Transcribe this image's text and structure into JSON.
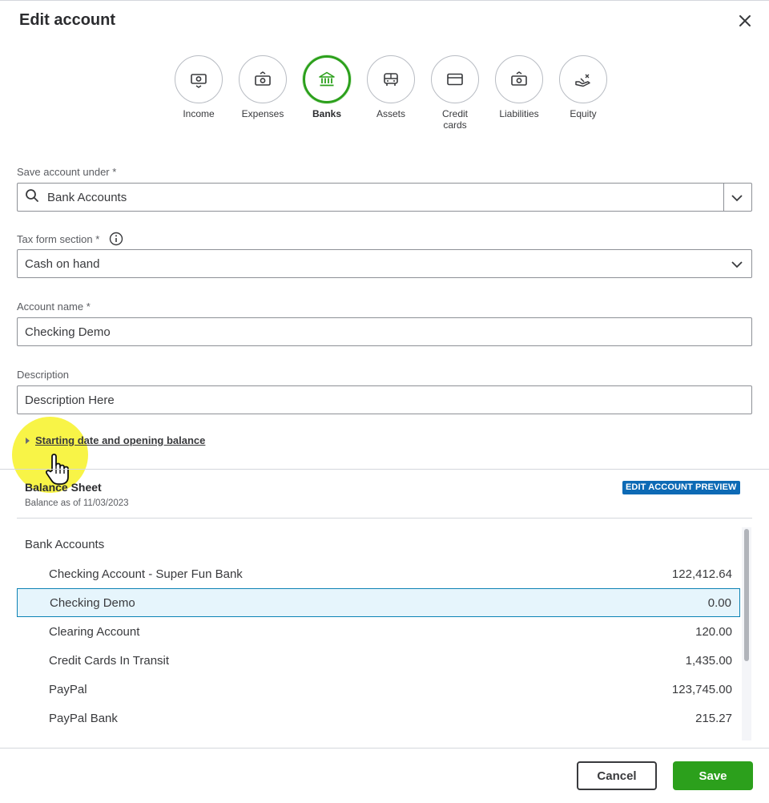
{
  "dialog": {
    "title": "Edit account"
  },
  "account_types": [
    {
      "label": "Income",
      "icon": "income-icon",
      "active": false
    },
    {
      "label": "Expenses",
      "icon": "expenses-icon",
      "active": false
    },
    {
      "label": "Banks",
      "icon": "bank-icon",
      "active": true
    },
    {
      "label": "Assets",
      "icon": "assets-icon",
      "active": false
    },
    {
      "label": "Credit cards",
      "icon": "credit-card-icon",
      "active": false
    },
    {
      "label": "Liabilities",
      "icon": "liabilities-icon",
      "active": false
    },
    {
      "label": "Equity",
      "icon": "equity-icon",
      "active": false
    }
  ],
  "form": {
    "save_under_label": "Save account under *",
    "save_under_value": "Bank Accounts",
    "tax_form_label": "Tax form section *",
    "tax_form_value": "Cash on hand",
    "account_name_label": "Account name *",
    "account_name_value": "Checking Demo",
    "description_label": "Description",
    "description_value": "Description Here",
    "opening_balance_link": "Starting date and opening balance"
  },
  "preview": {
    "title": "Balance Sheet",
    "subtitle": "Balance as of 11/03/2023",
    "badge": "EDIT ACCOUNT PREVIEW",
    "section": "Bank Accounts",
    "rows": [
      {
        "name": "Checking Account - Super Fun Bank",
        "amount": "122,412.64",
        "selected": false
      },
      {
        "name": "Checking Demo",
        "amount": "0.00",
        "selected": true
      },
      {
        "name": "Clearing Account",
        "amount": "120.00",
        "selected": false
      },
      {
        "name": "Credit Cards In Transit",
        "amount": "1,435.00",
        "selected": false
      },
      {
        "name": "PayPal",
        "amount": "123,745.00",
        "selected": false
      },
      {
        "name": "PayPal Bank",
        "amount": "215.27",
        "selected": false
      }
    ]
  },
  "footer": {
    "cancel_label": "Cancel",
    "save_label": "Save"
  },
  "colors": {
    "accent_green": "#2ca01c",
    "badge_blue": "#0d6ab5",
    "selection_bg": "#e6f5fc"
  }
}
